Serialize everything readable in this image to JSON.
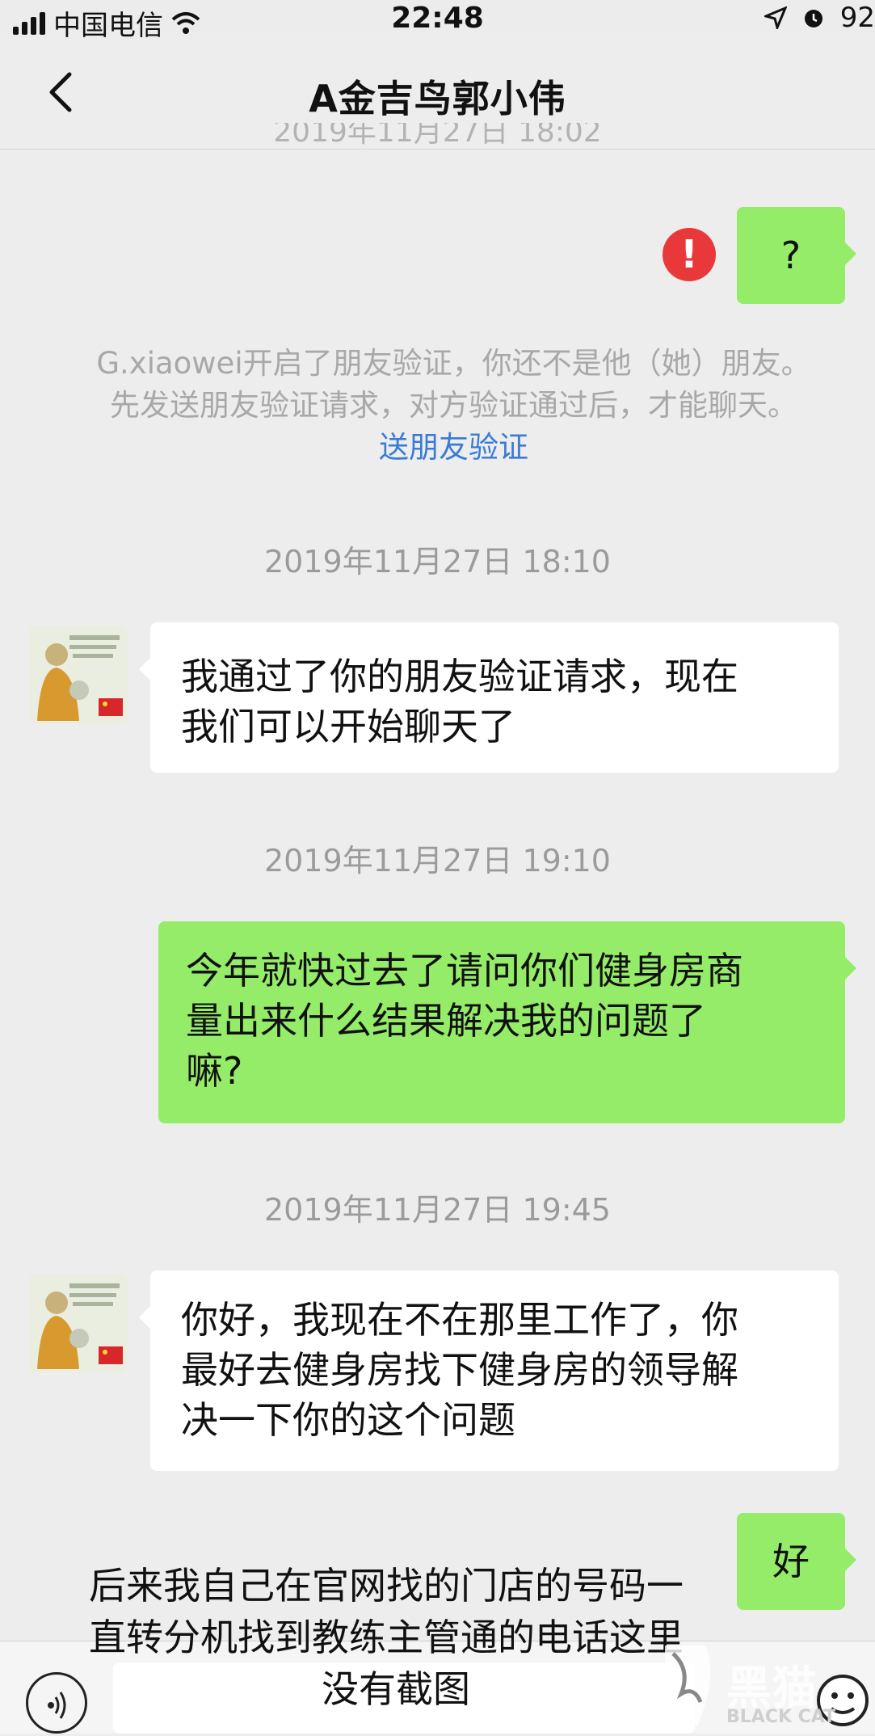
{
  "status_bar": {
    "carrier": "中国电信",
    "time": "22:48",
    "battery": "92"
  },
  "nav": {
    "title": "A金吉鸟郭小伟"
  },
  "faded_timestamp": "2019年11月27日 18:02",
  "messages": [
    {
      "type": "sent",
      "text": "?",
      "failed": true
    },
    {
      "type": "system",
      "line1": "G.xiaowei开启了朋友验证，你还不是他（她）朋友。",
      "line2": "先发送朋友验证请求，对方验证通过后，才能聊天。",
      "link": "送朋友验证"
    },
    {
      "type": "time",
      "text": "2019年11月27日 18:10"
    },
    {
      "type": "recv",
      "line1": "我通过了你的朋友验证请求，现在",
      "line2": "我们可以开始聊天了"
    },
    {
      "type": "time",
      "text": "2019年11月27日 19:10"
    },
    {
      "type": "sent",
      "line1": "今年就快过去了请问你们健身房商",
      "line2": "量出来什么结果解决我的问题了",
      "line3": "嘛?"
    },
    {
      "type": "time",
      "text": "2019年11月27日 19:45"
    },
    {
      "type": "recv",
      "line1": "你好，我现在不在那里工作了，你",
      "line2": "最好去健身房找下健身房的领导解",
      "line3": "决一下你的这个问题"
    },
    {
      "type": "sent",
      "text": "好"
    }
  ],
  "caption": {
    "line1": "后来我自己在官网找的门店的号码一",
    "line2": "直转分机找到教练主管通的电话这里",
    "line3": "没有截图"
  },
  "watermark": {
    "text_cn": "黑猫",
    "text_en": "BLACK CAT"
  },
  "colors": {
    "sent_bubble": "#95ec69",
    "recv_bubble": "#ffffff",
    "background": "#ededed",
    "error": "#e8383a",
    "link": "#3a7bd5"
  },
  "icons": [
    "back-arrow-icon",
    "signal-icon",
    "wifi-icon",
    "location-icon",
    "alarm-icon",
    "error-icon",
    "voice-icon"
  ]
}
